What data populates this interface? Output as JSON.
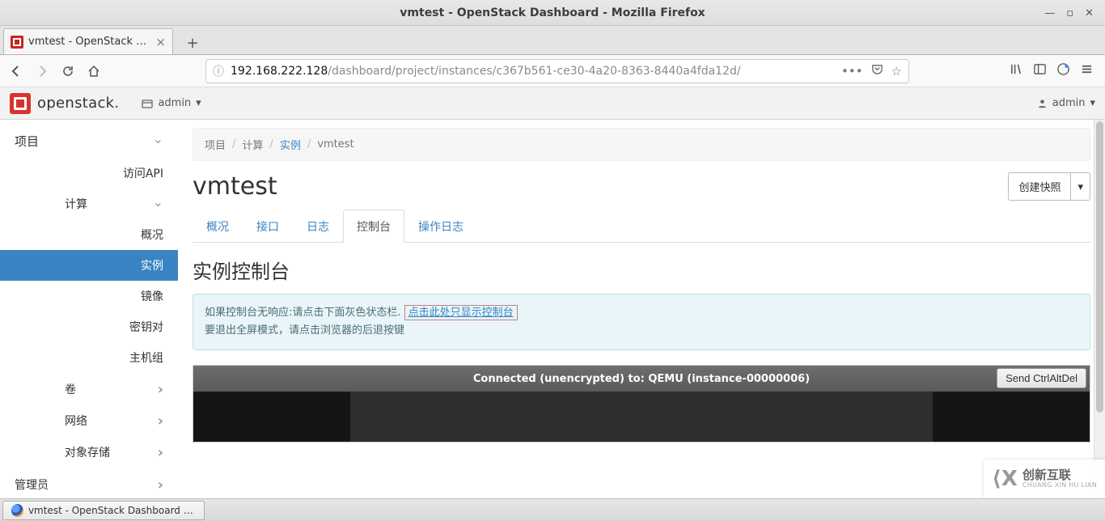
{
  "os_window": {
    "title": "vmtest - OpenStack Dashboard - Mozilla Firefox"
  },
  "browser_tab": {
    "label": "vmtest - OpenStack Dash"
  },
  "url": {
    "host": "192.168.222.128",
    "path": "/dashboard/project/instances/c367b561-ce30-4a20-8363-8440a4fda12d/"
  },
  "openstack": {
    "brand": "openstack.",
    "project_label": "admin",
    "user_label": "admin"
  },
  "sidebar": {
    "project": "项目",
    "api": "访问API",
    "compute": "计算",
    "overview": "概况",
    "instances": "实例",
    "images": "镜像",
    "keypairs": "密钥对",
    "hostgroups": "主机组",
    "volumes": "卷",
    "network": "网络",
    "objectstore": "对象存储",
    "admin": "管理员"
  },
  "breadcrumb": {
    "project": "项目",
    "compute": "计算",
    "instances": "实例",
    "current": "vmtest"
  },
  "page": {
    "title": "vmtest",
    "snapshot_btn": "创建快照"
  },
  "tabs": {
    "overview": "概况",
    "interfaces": "接口",
    "log": "日志",
    "console": "控制台",
    "actionlog": "操作日志"
  },
  "panel": {
    "heading": "实例控制台",
    "note_line1_a": "如果控制台无响应:请点击下面灰色状态栏.",
    "note_line1_link": "点击此处只显示控制台",
    "note_line2": "要退出全屏模式，请点击浏览器的后退按键"
  },
  "vnc": {
    "status": "Connected (unencrypted) to: QEMU (instance-00000006)",
    "send_cad": "Send CtrlAltDel"
  },
  "watermark": {
    "brand_zh": "创新互联",
    "brand_en": "CHUANG XIN HU LIAN"
  },
  "taskbar": {
    "item": "vmtest - OpenStack Dashboard - M..."
  }
}
